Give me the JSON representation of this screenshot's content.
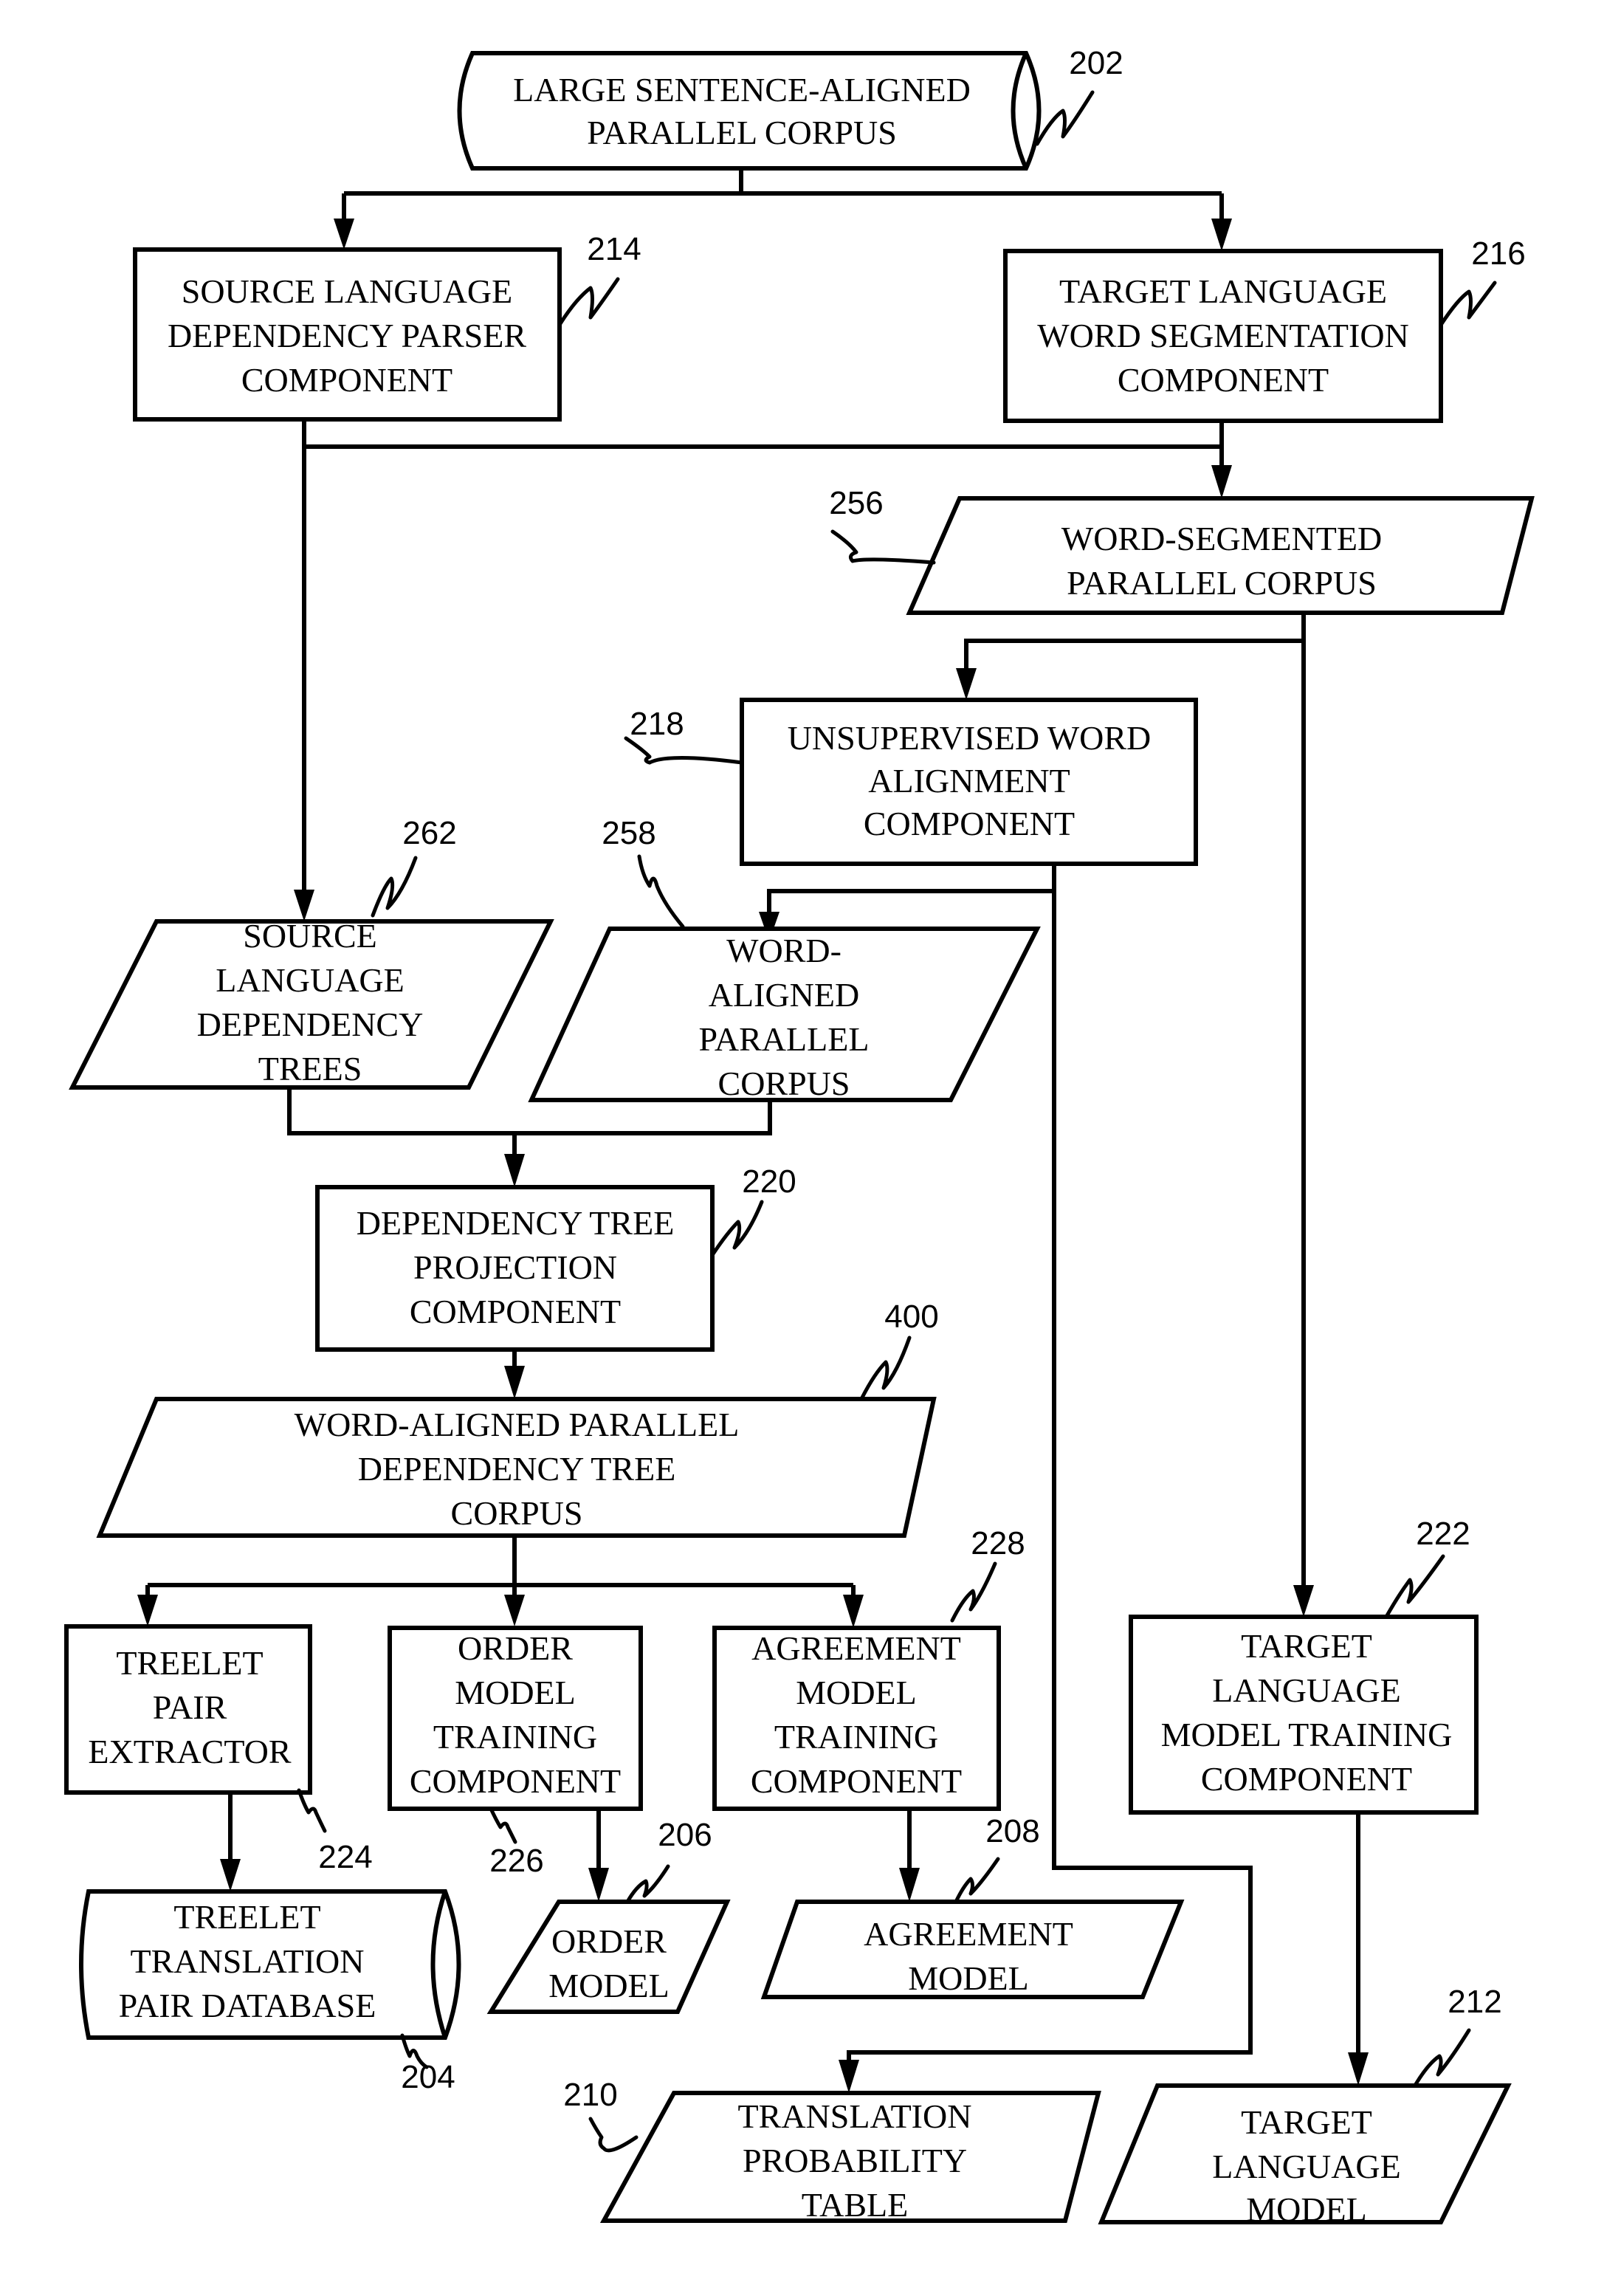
{
  "figure": {
    "nodes": {
      "corpus_202": {
        "lines": [
          "LARGE SENTENCE-ALIGNED",
          "PARALLEL CORPUS"
        ],
        "ref": "202",
        "kind": "database"
      },
      "parser_214": {
        "lines": [
          "SOURCE LANGUAGE",
          "DEPENDENCY PARSER",
          "COMPONENT"
        ],
        "ref": "214",
        "kind": "component"
      },
      "segmenter_216": {
        "lines": [
          "TARGET LANGUAGE",
          "WORD SEGMENTATION",
          "COMPONENT"
        ],
        "ref": "216",
        "kind": "component"
      },
      "segmented_256": {
        "lines": [
          "WORD-SEGMENTED",
          "PARALLEL CORPUS"
        ],
        "ref": "256",
        "kind": "data"
      },
      "aligner_218": {
        "lines": [
          "UNSUPERVISED WORD",
          "ALIGNMENT",
          "COMPONENT"
        ],
        "ref": "218",
        "kind": "component"
      },
      "trees_262": {
        "lines": [
          "SOURCE",
          "LANGUAGE",
          "DEPENDENCY",
          "TREES"
        ],
        "ref": "262",
        "kind": "data"
      },
      "aligned_258": {
        "lines": [
          "WORD-",
          "ALIGNED",
          "PARALLEL",
          "CORPUS"
        ],
        "ref": "258",
        "kind": "data"
      },
      "projection_220": {
        "lines": [
          "DEPENDENCY TREE",
          "PROJECTION",
          "COMPONENT"
        ],
        "ref": "220",
        "kind": "component"
      },
      "treecorpus_400": {
        "lines": [
          "WORD-ALIGNED PARALLEL",
          "DEPENDENCY TREE",
          "CORPUS"
        ],
        "ref": "400",
        "kind": "data"
      },
      "extractor_224": {
        "lines": [
          "TREELET",
          "PAIR",
          "EXTRACTOR"
        ],
        "ref": "224",
        "kind": "component"
      },
      "ordertrain_226": {
        "lines": [
          "ORDER",
          "MODEL",
          "TRAINING",
          "COMPONENT"
        ],
        "ref": "226",
        "kind": "component"
      },
      "agreetrain_228": {
        "lines": [
          "AGREEMENT",
          "MODEL",
          "TRAINING",
          "COMPONENT"
        ],
        "ref": "228",
        "kind": "component"
      },
      "lmtrain_222": {
        "lines": [
          "TARGET",
          "LANGUAGE",
          "MODEL TRAINING",
          "COMPONENT"
        ],
        "ref": "222",
        "kind": "component"
      },
      "treeletdb_204": {
        "lines": [
          "TREELET",
          "TRANSLATION",
          "PAIR DATABASE"
        ],
        "ref": "204",
        "kind": "database"
      },
      "ordermodel_206": {
        "lines": [
          "ORDER",
          "MODEL"
        ],
        "ref": "206",
        "kind": "data"
      },
      "agreemodel_208": {
        "lines": [
          "AGREEMENT",
          "MODEL"
        ],
        "ref": "208",
        "kind": "data"
      },
      "probtable_210": {
        "lines": [
          "TRANSLATION",
          "PROBABILITY",
          "TABLE"
        ],
        "ref": "210",
        "kind": "data"
      },
      "lm_212": {
        "lines": [
          "TARGET",
          "LANGUAGE",
          "MODEL"
        ],
        "ref": "212",
        "kind": "data"
      }
    },
    "edges": [
      {
        "from": "corpus_202",
        "to": "parser_214"
      },
      {
        "from": "corpus_202",
        "to": "segmenter_216"
      },
      {
        "from": "parser_214",
        "to": "segmented_256"
      },
      {
        "from": "segmenter_216",
        "to": "segmented_256"
      },
      {
        "from": "parser_214",
        "to": "trees_262"
      },
      {
        "from": "segmented_256",
        "to": "aligner_218"
      },
      {
        "from": "segmented_256",
        "to": "lmtrain_222"
      },
      {
        "from": "aligner_218",
        "to": "aligned_258"
      },
      {
        "from": "aligner_218",
        "to": "probtable_210"
      },
      {
        "from": "trees_262",
        "to": "projection_220"
      },
      {
        "from": "aligned_258",
        "to": "projection_220"
      },
      {
        "from": "projection_220",
        "to": "treecorpus_400"
      },
      {
        "from": "treecorpus_400",
        "to": "extractor_224"
      },
      {
        "from": "treecorpus_400",
        "to": "ordertrain_226"
      },
      {
        "from": "treecorpus_400",
        "to": "agreetrain_228"
      },
      {
        "from": "extractor_224",
        "to": "treeletdb_204"
      },
      {
        "from": "ordertrain_226",
        "to": "ordermodel_206"
      },
      {
        "from": "agreetrain_228",
        "to": "agreemodel_208"
      },
      {
        "from": "lmtrain_222",
        "to": "lm_212"
      }
    ]
  }
}
